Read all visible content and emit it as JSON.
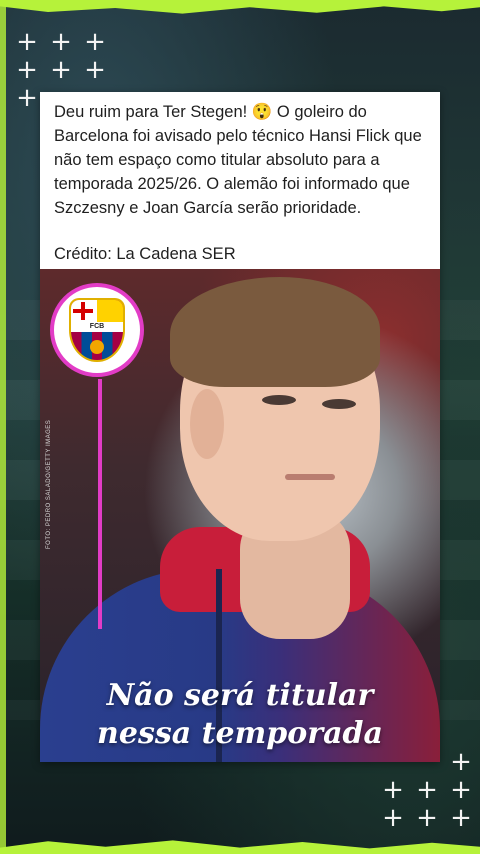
{
  "post": {
    "caption_line": "Deu ruim para Ter Stegen! 😲 O goleiro do Barcelona foi avisado pelo técnico Hansi Flick que não tem espaço como titular absoluto para a temporada 2025/26. O alemão foi informado que Szczesny e Joan García serão prioridade.",
    "credit": "Crédito: La Cadena SER"
  },
  "image": {
    "headline_line1": "Não será titular",
    "headline_line2": "nessa temporada",
    "badge_text": "FCB",
    "photo_credit": "FOTO: PEDRO SALADO/GETTY IMAGES",
    "badge_border_color": "#e23cc6",
    "icon": "fc-barcelona-crest-icon"
  },
  "theme": {
    "edge_color": "#b6f23a",
    "decor_symbol": "+"
  }
}
